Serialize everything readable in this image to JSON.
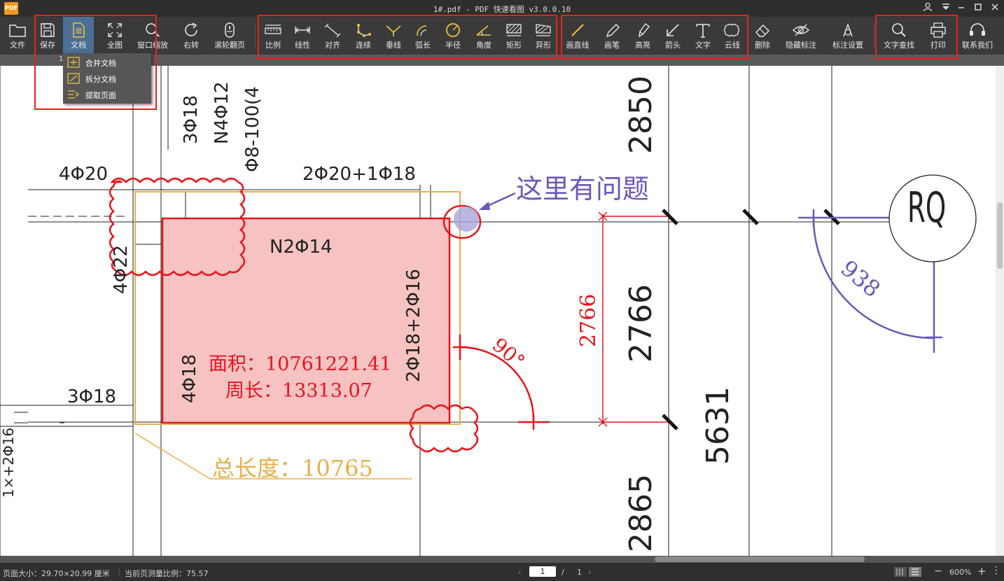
{
  "window": {
    "title": "1#.pdf - PDF 快速看图 v3.0.0.10",
    "logo": "PDF"
  },
  "toolbar": {
    "file": "文件",
    "save": "保存",
    "doc": "文档",
    "fit": "全图",
    "window_zoom": "窗口缩放",
    "rotate": "右转",
    "scroll_page": "滚轮翻页",
    "measure": [
      "比例",
      "线性",
      "对齐",
      "连续",
      "垂线",
      "弧长",
      "半径",
      "角度",
      "矩形",
      "异形"
    ],
    "draw": [
      "画直线",
      "画笔",
      "高亮",
      "箭头",
      "文字",
      "云线"
    ],
    "delete": "删除",
    "hide_marks": "隐藏标注",
    "mark_settings": "标注设置",
    "text_search": "文字查找",
    "print": "打印",
    "contact": "联系我们"
  },
  "doc_menu": {
    "items": [
      "合并文档",
      "拆分文档",
      "提取页面"
    ]
  },
  "tab_strip": {
    "label": "1"
  },
  "drawing": {
    "labels": {
      "t_4phi20": "4Φ20",
      "t_2phi20_1phi18": "2Φ20+1Φ18",
      "t_3phi18_v": "3Φ18",
      "t_n4phi12": "N4Φ12",
      "t_phi8": "Φ8-100(4",
      "t_4phi22": "4Φ22",
      "t_n2phi14": "N2Φ14",
      "t_2phi18_2phi16": "2Φ18+2Φ16",
      "t_4phi18": "4Φ18",
      "t_3phi18_h": "3Φ18",
      "t_2850": "2850",
      "t_2766": "2766",
      "t_5631": "5631",
      "t_2865": "2865",
      "t_rq": "RQ",
      "t_cut": "1×+2Φ16"
    },
    "annotations": {
      "area": "面积：10761221.41",
      "perimeter": "周长：13313.07",
      "total_length": "总长度：10765",
      "question": "这里有问题",
      "angle": "90°",
      "dim_red": "2766",
      "arc_len": "938"
    },
    "colors": {
      "red": "#e8141c",
      "orange": "#e8b04a",
      "purple": "#6b59b8",
      "fill_pink": "#f7c2c2",
      "black": "#222222"
    }
  },
  "status": {
    "page_size": "页面大小：29.70×20.99 厘米",
    "scale": "当前页测量比例：75.57",
    "page_current": "1",
    "page_sep": "/",
    "page_total": "1",
    "zoom": "600%"
  }
}
